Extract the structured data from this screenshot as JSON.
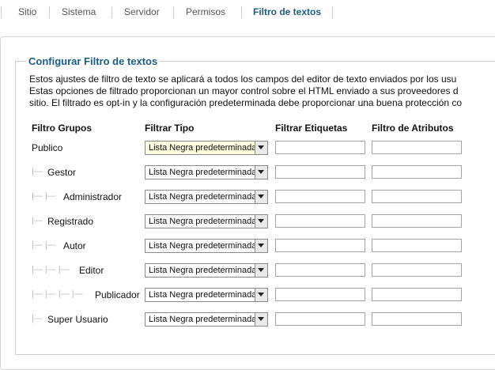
{
  "tabs": [
    {
      "label": "Sitio",
      "active": false
    },
    {
      "label": "Sistema",
      "active": false
    },
    {
      "label": "Servidor",
      "active": false
    },
    {
      "label": "Permisos",
      "active": false
    },
    {
      "label": "Filtro de textos",
      "active": true
    }
  ],
  "section": {
    "legend": "Configurar Filtro de textos",
    "description": [
      "Estos ajustes de filtro de texto se aplicará a todos los campos del editor de texto enviados por los usu",
      "Estas opciones de filtrado proporcionan un mayor control sobre el HTML enviado a sus proveedores d",
      "sitio. El filtrado es opt-in y la configuración predeterminada debe proporcionar una buena protección co"
    ]
  },
  "table": {
    "headers": [
      "Filtro Grupos",
      "Filtrar Tipo",
      "Filtrar Etiquetas",
      "Filtro de Atributos"
    ],
    "rows": [
      {
        "group": "Publico",
        "tree": "",
        "filter_type": "Lista Negra predeterminada",
        "tags": "",
        "attributes": ""
      },
      {
        "group": "Gestor",
        "tree": "|—",
        "filter_type": "Lista Negra predeterminada",
        "tags": "",
        "attributes": ""
      },
      {
        "group": "Administrador",
        "tree": "|— |—",
        "filter_type": "Lista Negra predeterminada",
        "tags": "",
        "attributes": ""
      },
      {
        "group": "Registrado",
        "tree": "|—",
        "filter_type": "Lista Negra predeterminada",
        "tags": "",
        "attributes": ""
      },
      {
        "group": "Autor",
        "tree": "|— |—",
        "filter_type": "Lista Negra predeterminada",
        "tags": "",
        "attributes": ""
      },
      {
        "group": "Editor",
        "tree": "|— |— |—",
        "filter_type": "Lista Negra predeterminada",
        "tags": "",
        "attributes": ""
      },
      {
        "group": "Publicador",
        "tree": "|— |— |— |—",
        "filter_type": "Lista Negra predeterminada",
        "tags": "",
        "attributes": ""
      },
      {
        "group": "Super Usuario",
        "tree": "|—",
        "filter_type": "Lista Negra predeterminada",
        "tags": "",
        "attributes": ""
      }
    ]
  },
  "colors": {
    "accent": "#1b5c84",
    "border": "#cccccc"
  }
}
